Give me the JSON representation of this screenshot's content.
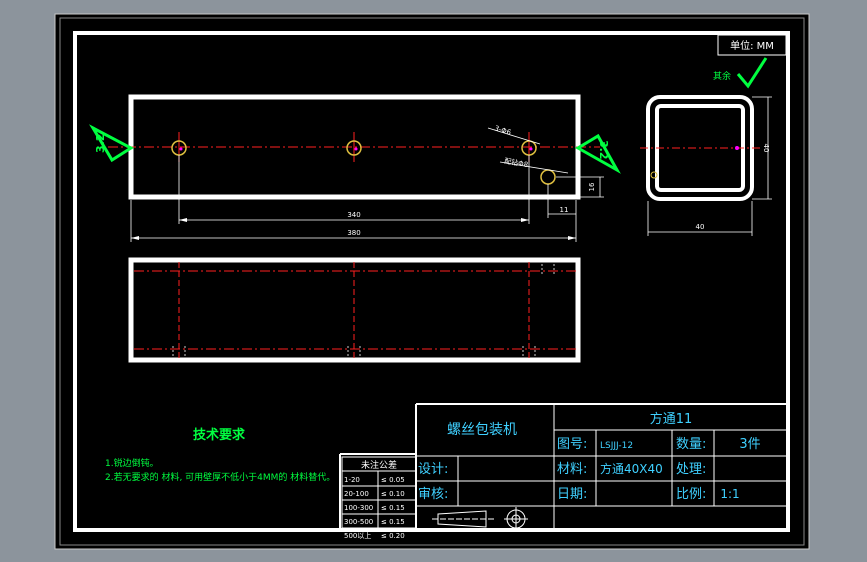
{
  "colors": {
    "background": "#8c949c",
    "sheet": "#000000",
    "outline": "#ffffff",
    "center_line": "#ff2020",
    "dimension": "#ffffff",
    "annotation": "#00ff40",
    "title_text": "#3fd0ff",
    "hole": "#e0c040",
    "accent": "#ff00ff"
  },
  "unit_box": {
    "label": "单位: MM"
  },
  "roughness": {
    "label": "其余",
    "left_value": "3.2",
    "right_value": "3.2"
  },
  "dimensions": {
    "hole_spacing": "340",
    "overall_length": "380",
    "end_offset": "11",
    "hole_height": "16",
    "tube_width": "40",
    "tube_height": "40",
    "hole_note_1": "3-Φ6",
    "hole_note_2": "配钻Φ8"
  },
  "tech_requirements": {
    "title": "技术要求",
    "items": [
      "1.锐边倒钝。",
      "2.若无要求的 材料, 可用壁厚不低小于4MM的 材料替代。"
    ]
  },
  "tolerance_table": {
    "title": "未注公差",
    "rows": [
      {
        "range": "1-20",
        "value": "≤ 0.05"
      },
      {
        "range": "20-100",
        "value": "≤ 0.10"
      },
      {
        "range": "100-300",
        "value": "≤ 0.15"
      },
      {
        "range": "300-500",
        "value": "≤ 0.15"
      },
      {
        "range": "500以上",
        "value": "≤ 0.20"
      }
    ]
  },
  "title_block": {
    "project": "螺丝包装机",
    "part_name": "方通11",
    "drawing_no_label": "图号:",
    "drawing_no": "LSJJJ-12",
    "quantity_label": "数量:",
    "quantity": "3件",
    "material_label": "材料:",
    "material": "方通40X40",
    "process_label": "处理:",
    "process": "",
    "date_label": "日期:",
    "date": "",
    "scale_label": "比例:",
    "scale": "1:1",
    "design_label": "设计:",
    "review_label": "审核:"
  }
}
